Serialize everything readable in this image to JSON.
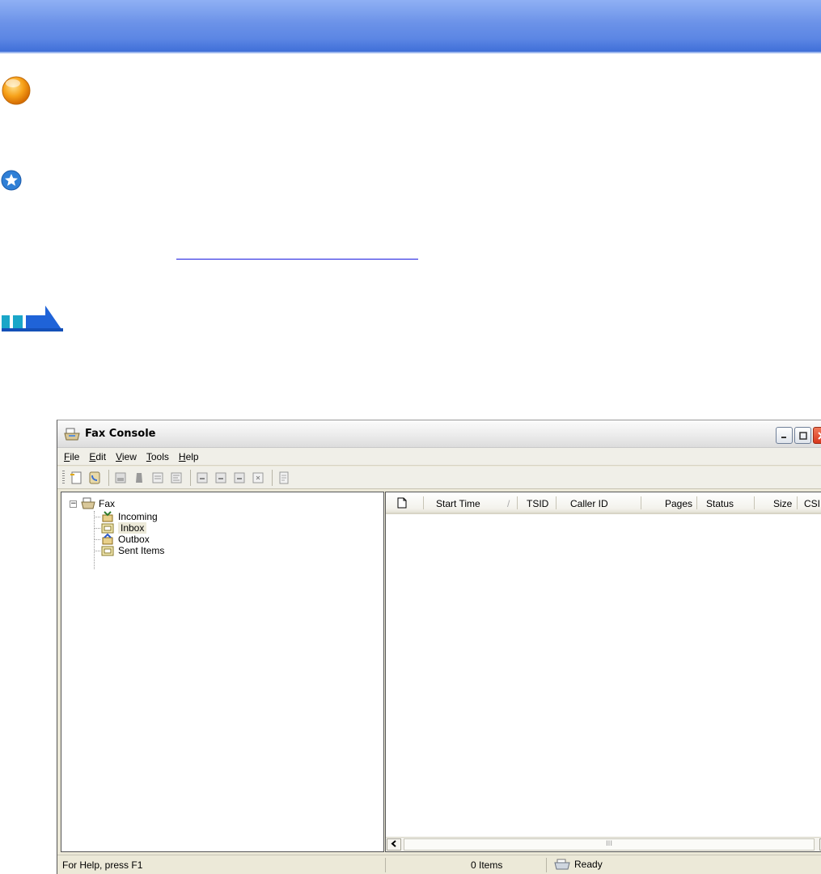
{
  "page": {
    "link_text": ""
  },
  "window": {
    "title": "Fax Console",
    "icon": "fax-printer-icon",
    "caption_buttons": [
      "minimize",
      "maximize",
      "close"
    ]
  },
  "menubar": {
    "items": [
      {
        "label": "File"
      },
      {
        "label": "Edit"
      },
      {
        "label": "View"
      },
      {
        "label": "Tools"
      },
      {
        "label": "Help"
      }
    ]
  },
  "toolbar": {
    "buttons": [
      "new-fax-icon",
      "receive-now-icon",
      "view-icon",
      "print-icon",
      "save-as-icon",
      "mail-to-icon",
      "reply-icon",
      "forward-icon",
      "pause-icon",
      "resume-icon",
      "delete-icon"
    ]
  },
  "tree": {
    "root": "Fax",
    "items": [
      {
        "label": "Incoming",
        "icon": "incoming-icon"
      },
      {
        "label": "Inbox",
        "icon": "inbox-icon",
        "selected": true
      },
      {
        "label": "Outbox",
        "icon": "outbox-icon"
      },
      {
        "label": "Sent Items",
        "icon": "sent-items-icon"
      }
    ]
  },
  "list": {
    "columns": {
      "doc_icon": "document-icon",
      "start_time": "Start Time",
      "sort_indicator": "/",
      "tsid": "TSID",
      "caller_id": "Caller ID",
      "pages": "Pages",
      "status": "Status",
      "size": "Size",
      "csid": "CSII"
    },
    "rows": [],
    "scroll_grip": "III"
  },
  "statusbar": {
    "help": "For Help, press F1",
    "items": "0 Items",
    "ready": "Ready"
  },
  "colors": {
    "banner": "#6b92e8",
    "link": "#1a1ae0",
    "window_face": "#ece9d8"
  }
}
